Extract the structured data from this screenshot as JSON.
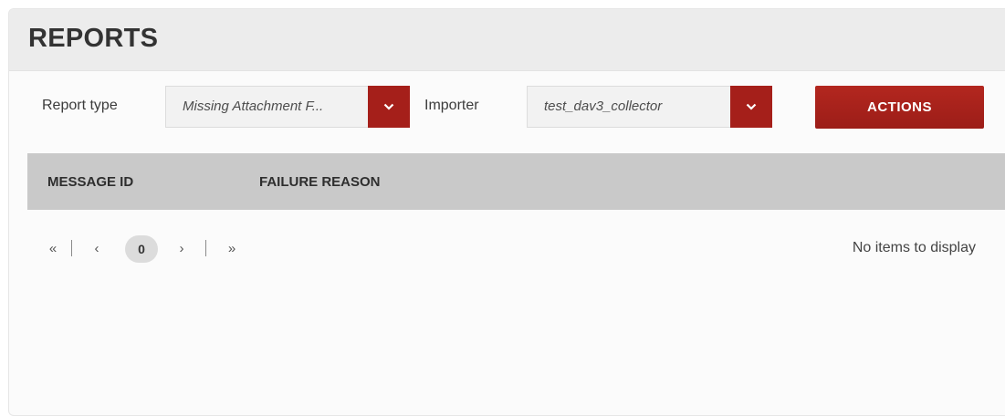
{
  "panel": {
    "title": "REPORTS"
  },
  "filters": {
    "report_type": {
      "label": "Report type",
      "value": "Missing Attachment F..."
    },
    "importer": {
      "label": "Importer",
      "value": "test_dav3_collector"
    },
    "actions_label": "ACTIONS"
  },
  "table": {
    "columns": [
      "MESSAGE ID",
      "FAILURE REASON"
    ]
  },
  "pager": {
    "first": "«",
    "prev": "‹",
    "current_page": "0",
    "next": "›",
    "last": "»",
    "empty_text": "No items to display"
  },
  "colors": {
    "accent": "#a51f1a",
    "header_bg": "#c9c9c9",
    "panel_header_bg": "#ececec"
  },
  "icons": {
    "dropdown": "chevron-down-icon"
  }
}
